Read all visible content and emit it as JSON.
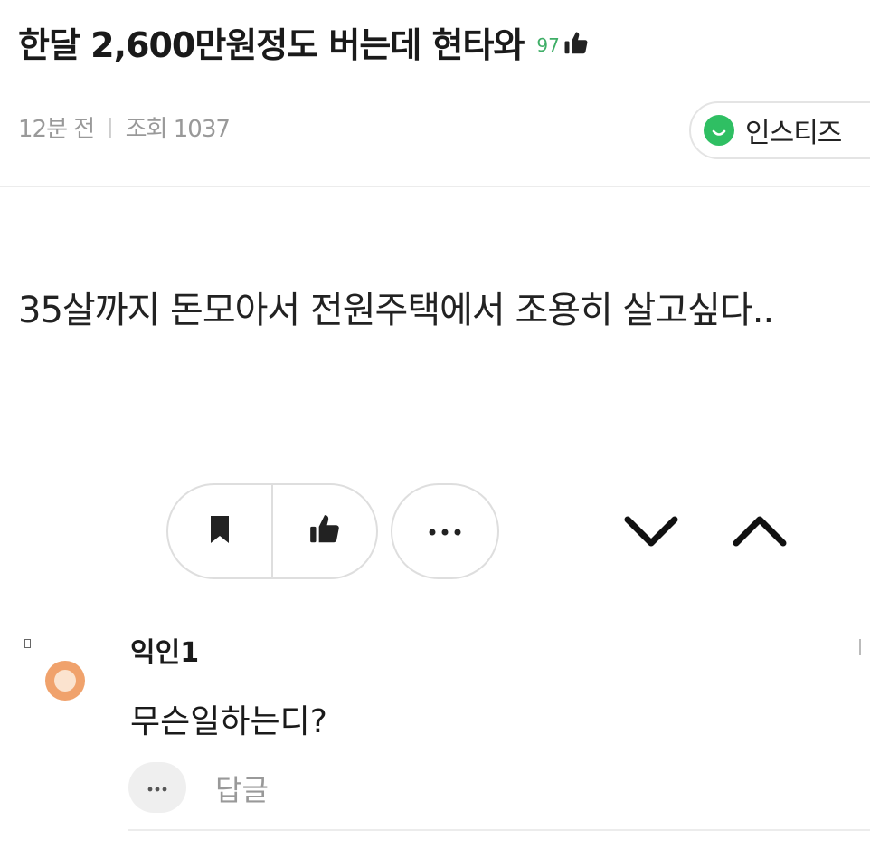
{
  "post": {
    "title": "한달 2,600만원정도 버는데 현타와",
    "like_count": "97",
    "time_ago": "12분 전",
    "views": "조회 1037",
    "author": "인스티즈",
    "body": "35살까지 돈모아서 전원주택에서 조용히 살고싶다..",
    "accent_color": "#3fae67"
  },
  "actions": {
    "bookmark_icon": "bookmark-icon",
    "like_icon": "thumbs-up-icon",
    "more_icon": "more-dots-icon",
    "next_icon": "chevron-down-icon",
    "prev_icon": "chevron-up-icon"
  },
  "comment": {
    "author": "익인1",
    "text": "무슨일하는디?",
    "reply_label": "답글",
    "avatar_color": "#f0a26c"
  }
}
